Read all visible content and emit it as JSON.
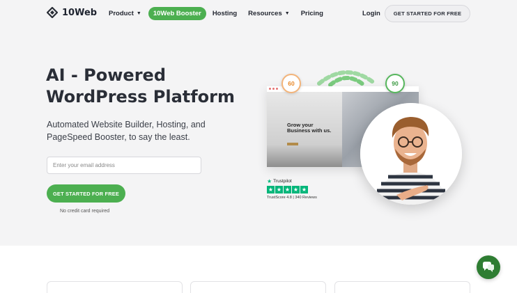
{
  "nav": {
    "logo": "10Web",
    "links": [
      {
        "label": "Product",
        "dropdown": true
      },
      {
        "label": "10Web Booster",
        "highlight": true
      },
      {
        "label": "Hosting",
        "dropdown": false
      },
      {
        "label": "Resources",
        "dropdown": true
      },
      {
        "label": "Pricing",
        "dropdown": false
      }
    ],
    "login": "Login",
    "cta": "GET STARTED FOR FREE"
  },
  "hero": {
    "title_line1": "AI - Powered",
    "title_line2": "WordPress Platform",
    "subtitle": "Automated Website Builder, Hosting, and PageSpeed Booster, to say the least.",
    "email_placeholder": "Enter your email address",
    "cta": "GET STARTED FOR FREE",
    "note": "No credit card required"
  },
  "visual": {
    "score_before": "60",
    "score_after": "90",
    "mock_heading_line1": "Grow your",
    "mock_heading_line2": "Business with us.",
    "trustpilot_name": "Trustpilot",
    "trustpilot_score": "TrustScore 4.8 | 340 Reviews"
  },
  "colors": {
    "accent": "#4caf50",
    "trustpilot": "#00b67a",
    "chat": "#2e7d32"
  },
  "icons": {
    "chat": "chat-bubbles-icon",
    "logo": "10web-logo-icon"
  }
}
